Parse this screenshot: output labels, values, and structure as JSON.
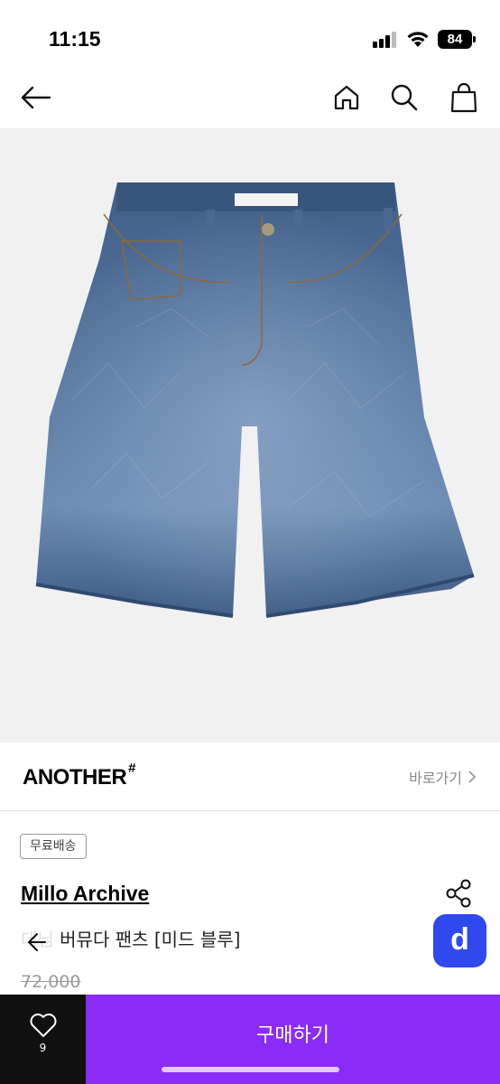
{
  "status_bar": {
    "time": "11:15",
    "battery": "84"
  },
  "nav": {
    "back_icon": "arrow-left-icon",
    "home_icon": "home-icon",
    "search_icon": "search-icon",
    "bag_icon": "shopping-bag-icon"
  },
  "product_image": {
    "label_text": "",
    "denim_color": "#4a6a93"
  },
  "brand": {
    "logo": "ANOTHER",
    "logo_mark": "#",
    "shortcut": "바로가기"
  },
  "info": {
    "badge": "무료배송",
    "shop_name": "Millo Archive",
    "product_name": "데님 버뮤다 팬츠 [미드 블루]",
    "price": "72,000",
    "share_icon": "share-icon",
    "app_button": "d"
  },
  "bottom": {
    "like_icon": "heart-icon",
    "like_count": "9",
    "buy_label": "구매하기"
  },
  "colors": {
    "accent": "#8b2bf8",
    "app_blue": "#2f49ef"
  }
}
